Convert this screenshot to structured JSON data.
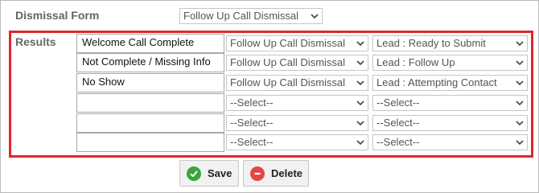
{
  "form": {
    "label": "Dismissal Form",
    "selected": "Follow Up Call Dismissal"
  },
  "results": {
    "label": "Results",
    "rows": [
      {
        "text": "Welcome Call Complete",
        "form": "Follow Up Call Dismissal",
        "status": "Lead : Ready to Submit"
      },
      {
        "text": "Not Complete / Missing Info",
        "form": "Follow Up Call Dismissal",
        "status": "Lead : Follow Up"
      },
      {
        "text": "No Show",
        "form": "Follow Up Call Dismissal",
        "status": "Lead : Attempting Contact"
      },
      {
        "text": "",
        "form": "--Select--",
        "status": "--Select--"
      },
      {
        "text": "",
        "form": "--Select--",
        "status": "--Select--"
      },
      {
        "text": "",
        "form": "--Select--",
        "status": "--Select--"
      }
    ]
  },
  "buttons": {
    "save": "Save",
    "delete": "Delete"
  },
  "icons": {
    "save": "check-circle-icon",
    "delete": "minus-circle-icon",
    "dropdown": "chevron-down-icon"
  },
  "colors": {
    "highlight_border": "#e3262b",
    "save_icon": "#3aa63a",
    "delete_icon": "#e04848"
  }
}
